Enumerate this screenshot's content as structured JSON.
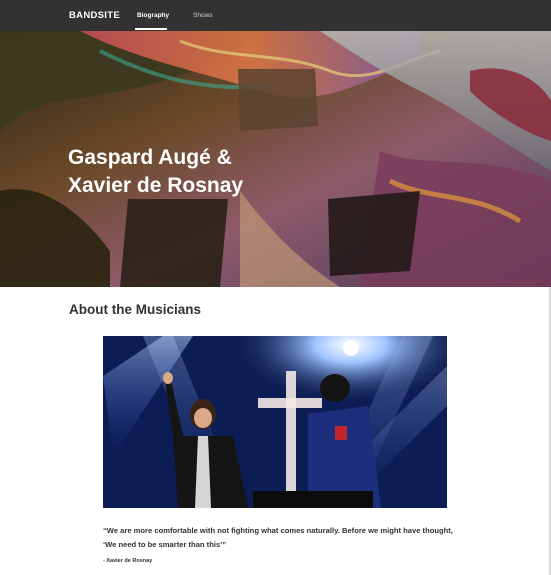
{
  "nav": {
    "logo": "BANDSITE",
    "links": [
      {
        "label": "Biography",
        "active": true
      },
      {
        "label": "Shows",
        "active": false
      }
    ]
  },
  "hero": {
    "title_line1": "Gaspard Augé &",
    "title_line2": "Xavier de Rosnay"
  },
  "about": {
    "heading": "About the Musicians",
    "quote": "“We are more comfortable with not fighting what comes naturally. Before we might have thought, ‘We need to be smarter than this’”",
    "attribution": "- Xavier de Rosnay"
  },
  "colors": {
    "nav_bg": "#323232",
    "text": "#323232",
    "background": "#ffffff"
  }
}
